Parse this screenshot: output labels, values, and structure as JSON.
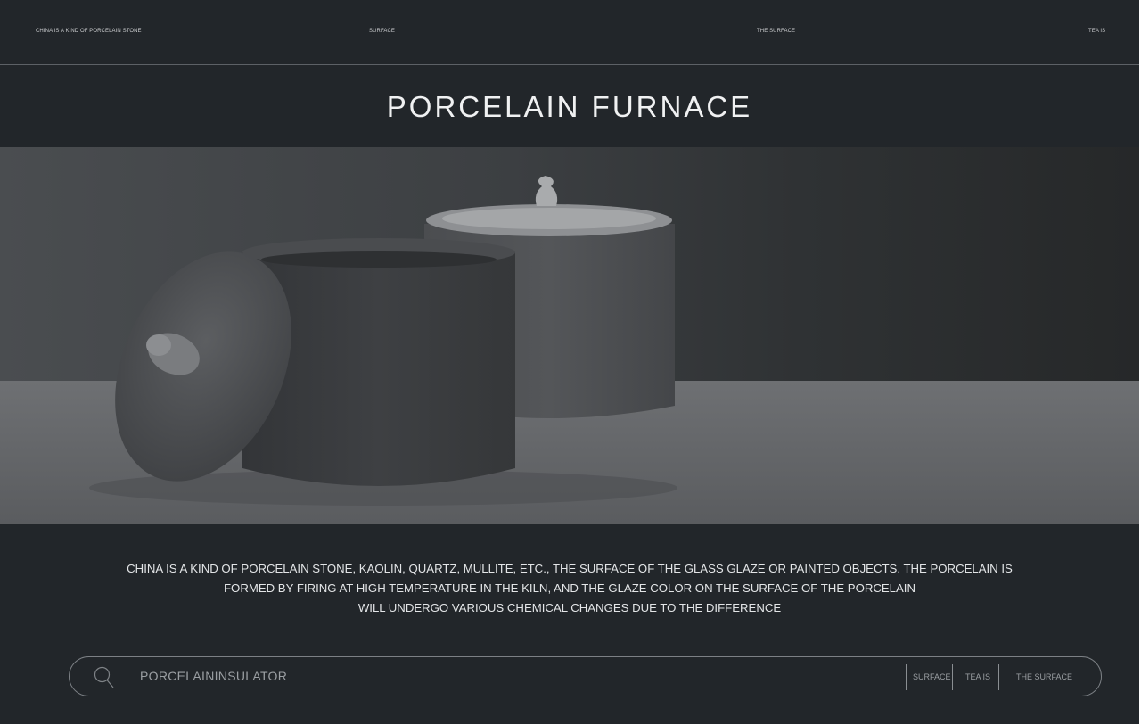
{
  "nav": {
    "brand": "CHINA IS A KIND OF PORCELAIN STONE",
    "link_1": "SURFACE",
    "link_2": "THE SURFACE",
    "link_3": "TEA IS"
  },
  "title": "PORCELAIN FURNACE",
  "hero": {
    "image_subject": "two lidded ceramic jars on a table"
  },
  "description": {
    "line_1": "CHINA IS A KIND OF PORCELAIN STONE, KAOLIN, QUARTZ, MULLITE, ETC., THE SURFACE OF THE GLASS GLAZE OR PAINTED OBJECTS. THE PORCELAIN IS",
    "line_2": "FORMED BY FIRING AT HIGH TEMPERATURE IN THE KILN, AND THE GLAZE COLOR ON THE SURFACE OF THE PORCELAIN",
    "line_3": "WILL UNDERGO VARIOUS CHEMICAL CHANGES DUE TO THE DIFFERENCE"
  },
  "search_bar": {
    "icon": "search-icon",
    "value": "PORCELAININSULATOR",
    "links": [
      "SURFACE",
      "TEA IS",
      "THE SURFACE"
    ]
  },
  "colors": {
    "background": "#22262a",
    "text": "#f0f1f2",
    "muted": "#9b9fa3",
    "divider": "#5d6166"
  }
}
